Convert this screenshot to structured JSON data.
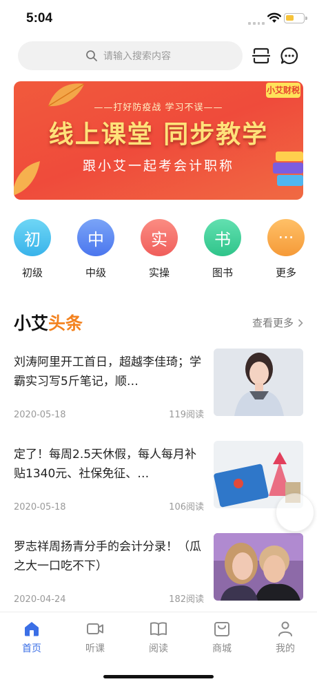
{
  "status": {
    "time": "5:04"
  },
  "search": {
    "placeholder": "请输入搜索内容"
  },
  "banner": {
    "subtitle": "——打好防疫战 学习不误——",
    "title": "线上课堂 同步教学",
    "caption": "跟小艾一起考会计职称",
    "logo": "小艾财税"
  },
  "categories": [
    {
      "glyph": "初",
      "label": "初级",
      "color": "#4cc3ef"
    },
    {
      "glyph": "中",
      "label": "中级",
      "color": "#5b86f2"
    },
    {
      "glyph": "实",
      "label": "实操",
      "color": "#f4706b"
    },
    {
      "glyph": "书",
      "label": "图书",
      "color": "#3fcf9a"
    },
    {
      "glyph": "···",
      "label": "更多",
      "color": "#f7a94a"
    }
  ],
  "section": {
    "title_main": "小艾",
    "title_accent": "头条",
    "more": "查看更多"
  },
  "articles": [
    {
      "title": "刘涛阿里开工首日，超越李佳琦；学霸实习写5斤笔记，顺…",
      "date": "2020-05-18",
      "reads": "119阅读"
    },
    {
      "title": "定了！每周2.5天休假，每人每月补贴1340元、社保免征、…",
      "date": "2020-05-18",
      "reads": "106阅读"
    },
    {
      "title": "罗志祥周扬青分手的会计分录！（瓜之大一口吃不下）",
      "date": "2020-04-24",
      "reads": "182阅读"
    }
  ],
  "tabs": [
    {
      "label": "首页",
      "icon": "home-icon",
      "active": true
    },
    {
      "label": "听课",
      "icon": "video-icon",
      "active": false
    },
    {
      "label": "阅读",
      "icon": "book-icon",
      "active": false
    },
    {
      "label": "商城",
      "icon": "shop-bag-icon",
      "active": false
    },
    {
      "label": "我的",
      "icon": "person-icon",
      "active": false
    }
  ],
  "colors": {
    "accent": "#3b6fe6",
    "orange": "#f3821f",
    "banner": "#ef4b3b"
  }
}
